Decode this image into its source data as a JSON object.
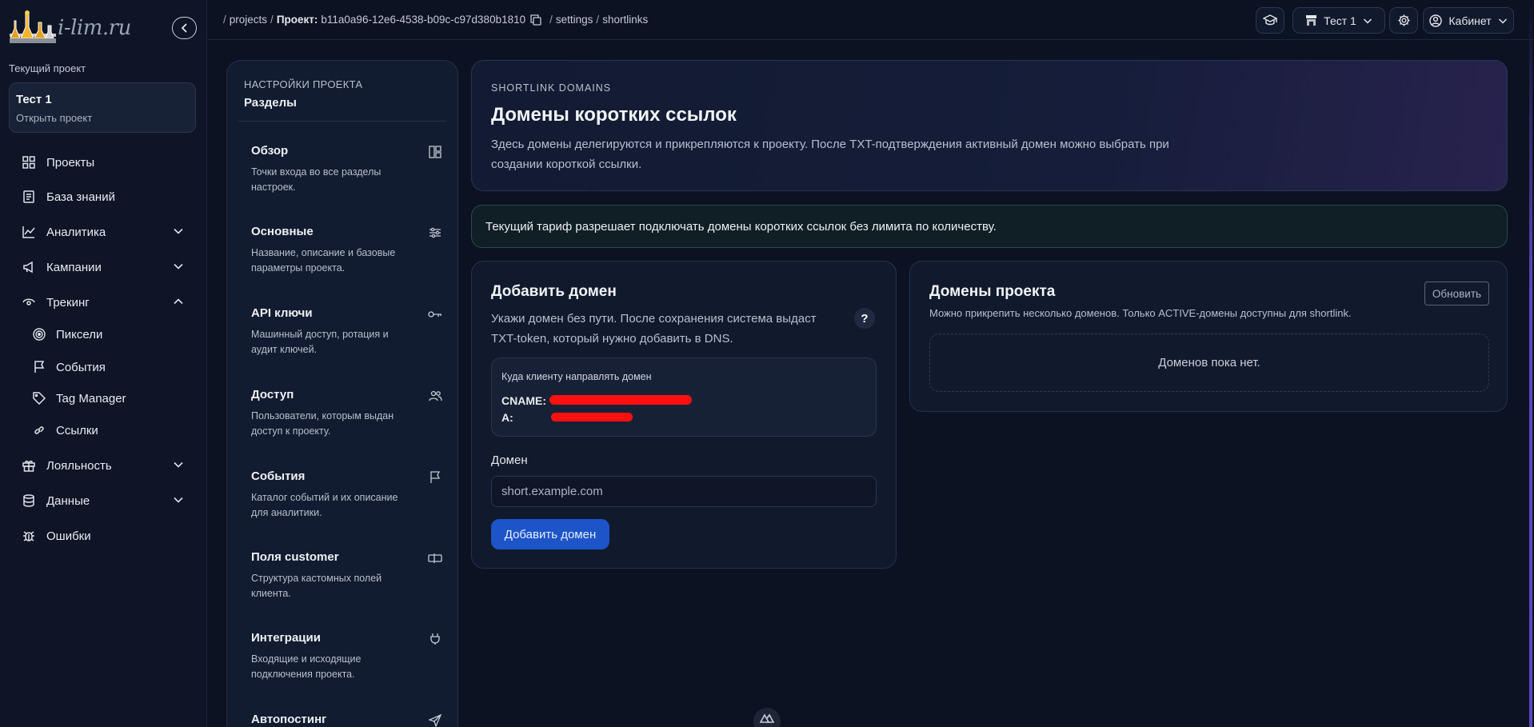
{
  "logo": {
    "text": "i-lim.ru",
    "icon": "flasks-logo"
  },
  "sidebar": {
    "current_project_label": "Текущий проект",
    "current_project": {
      "name": "Тест 1",
      "open_label": "Открыть проект"
    },
    "items": [
      {
        "label": "Проекты",
        "icon": "grid-icon"
      },
      {
        "label": "База знаний",
        "icon": "book-icon"
      },
      {
        "label": "Аналитика",
        "icon": "chart-icon",
        "expandable": true,
        "expanded": false
      },
      {
        "label": "Кампании",
        "icon": "megaphone-icon",
        "expandable": true,
        "expanded": false
      },
      {
        "label": "Трекинг",
        "icon": "tracking-icon",
        "expandable": true,
        "expanded": true
      },
      {
        "label": "Лояльность",
        "icon": "gift-icon",
        "expandable": true,
        "expanded": false
      },
      {
        "label": "Данные",
        "icon": "database-icon",
        "expandable": true,
        "expanded": false
      },
      {
        "label": "Ошибки",
        "icon": "bug-icon"
      }
    ],
    "tracking_subitems": [
      {
        "label": "Пиксели",
        "icon": "target-icon"
      },
      {
        "label": "События",
        "icon": "flag-icon"
      },
      {
        "label": "Tag Manager",
        "icon": "tag-icon"
      },
      {
        "label": "Ссылки",
        "icon": "link-icon"
      }
    ]
  },
  "topbar": {
    "breadcrumb": {
      "projects": "projects",
      "project_label": "Проект:",
      "project_id": "b11a0a96-12e6-4538-b09c-c97d380b1810",
      "settings": "settings",
      "shortlinks": "shortlinks"
    },
    "project_selector": "Тест 1",
    "account_label": "Кабинет"
  },
  "sections": {
    "caption": "НАСТРОЙКИ ПРОЕКТА",
    "title": "Разделы",
    "items": [
      {
        "title": "Обзор",
        "desc": "Точки входа во все разделы настроек.",
        "icon": "layout-icon"
      },
      {
        "title": "Основные",
        "desc": "Название, описание и базовые параметры проекта.",
        "icon": "sliders-icon"
      },
      {
        "title": "API ключи",
        "desc": "Машинный доступ, ротация и аудит ключей.",
        "icon": "key-icon"
      },
      {
        "title": "Доступ",
        "desc": "Пользователи, которым выдан доступ к проекту.",
        "icon": "users-icon"
      },
      {
        "title": "События",
        "desc": "Каталог событий и их описание для аналитики.",
        "icon": "flag-icon"
      },
      {
        "title": "Поля customer",
        "desc": "Структура кастомных полей клиента.",
        "icon": "fields-icon"
      },
      {
        "title": "Интеграции",
        "desc": "Входящие и исходящие подключения проекта.",
        "icon": "plug-icon"
      },
      {
        "title": "Автопостинг",
        "desc": "",
        "icon": "send-icon"
      }
    ]
  },
  "hero": {
    "kicker": "SHORTLINK DOMAINS",
    "title": "Домены коротких ссылок",
    "desc": "Здесь домены делегируются и прикрепляются к проекту. После TXT-подтверждения активный домен можно выбрать при создании короткой ссылки."
  },
  "notice": "Текущий тариф разрешает подключать домены коротких ссылок без лимита по количеству.",
  "add_domain": {
    "title": "Добавить домен",
    "desc": "Укажи домен без пути. После сохранения система выдаст TXT-token, который нужно добавить в DNS.",
    "help": "?",
    "dns_caption": "Куда клиенту направлять домен",
    "cname_label": "CNAME:",
    "a_label": "A:",
    "field_label": "Домен",
    "field_placeholder": "short.example.com",
    "field_value": "",
    "submit_label": "Добавить домен"
  },
  "project_domains": {
    "title": "Домены проекта",
    "desc": "Можно прикрепить несколько доменов. Только ACTIVE-домены доступны для shortlink.",
    "refresh_label": "Обновить",
    "empty_text": "Доменов пока нет."
  },
  "colors": {
    "accent": "#1d55c9",
    "redaction": "#ff1010",
    "background": "#0b1222"
  }
}
